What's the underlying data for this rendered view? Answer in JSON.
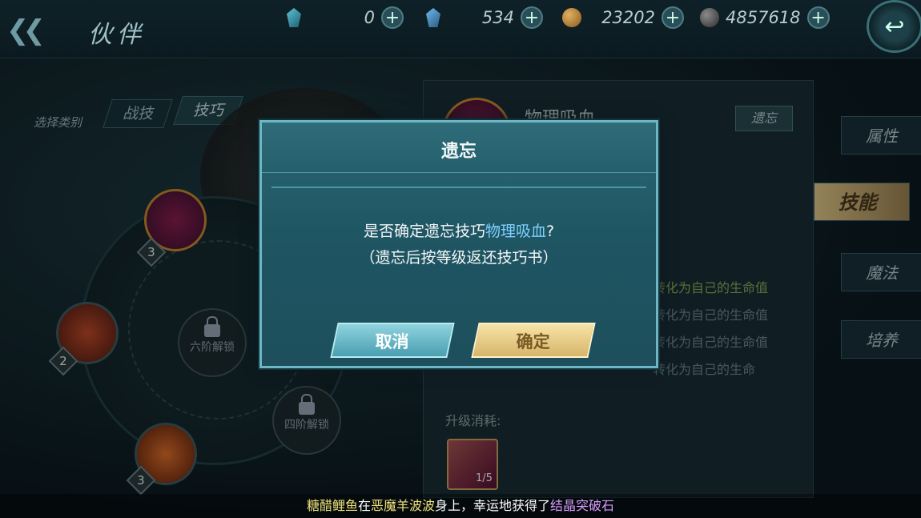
{
  "header": {
    "back_arrows": "❮❮",
    "title": "伙伴",
    "resources": [
      {
        "icon": "crystal-icon",
        "value": "0"
      },
      {
        "icon": "crystal-bound-icon",
        "value": "534"
      },
      {
        "icon": "gold-coin-icon",
        "value": "23202"
      },
      {
        "icon": "silver-coin-icon",
        "value": "4857618"
      }
    ],
    "plus": "+",
    "return_symbol": "↩"
  },
  "category": {
    "label": "选择类别",
    "tabs": [
      "战技",
      "技巧"
    ]
  },
  "wheel": {
    "skills": [
      {
        "level": "3"
      },
      {
        "level": "2"
      },
      {
        "level": "3"
      }
    ],
    "locked": [
      "六阶解锁",
      "四阶解锁"
    ]
  },
  "detail": {
    "skill_name": "物理吸血",
    "forget_label": "遗忘",
    "effects": [
      "转化为自己的生命值",
      "转化为自己的生命值",
      "转化为自己的生命值",
      "转化为自己的生命"
    ],
    "cost_label": "升级消耗:",
    "book_count": "1/5"
  },
  "side_tabs": [
    "属性",
    "技能",
    "魔法",
    "培养"
  ],
  "dialog": {
    "title": "遗忘",
    "msg_prefix": "是否确定遗忘技巧",
    "msg_skill": "物理吸血",
    "msg_suffix": "?",
    "note": "（遗忘后按等级返还技巧书）",
    "cancel": "取消",
    "confirm": "确定"
  },
  "ticker": {
    "player": "糖醋鲤鱼",
    "mid1": "在",
    "source": "恶魔羊波波",
    "mid2": "身上，幸运地获得了",
    "item": "结晶突破石"
  }
}
